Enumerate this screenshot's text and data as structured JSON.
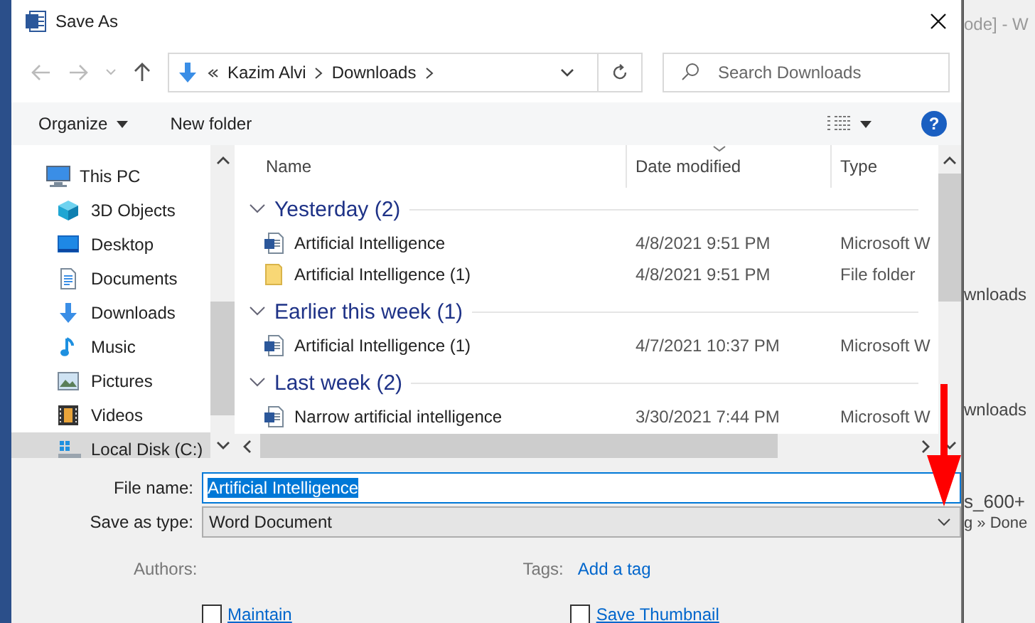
{
  "window": {
    "title": "Save As"
  },
  "address_bar": {
    "path": [
      "Kazim Alvi",
      "Downloads"
    ]
  },
  "search": {
    "placeholder": "Search Downloads"
  },
  "toolbar": {
    "organize": "Organize",
    "new_folder": "New folder",
    "help": "?"
  },
  "nav_items": [
    {
      "label": "This PC",
      "kind": "pc",
      "selected": false,
      "children": [
        {
          "label": "3D Objects",
          "kind": "cube",
          "selected": false
        },
        {
          "label": "Desktop",
          "kind": "desktop",
          "selected": false
        },
        {
          "label": "Documents",
          "kind": "documents",
          "selected": false
        },
        {
          "label": "Downloads",
          "kind": "downloads",
          "selected": false
        },
        {
          "label": "Music",
          "kind": "music",
          "selected": false
        },
        {
          "label": "Pictures",
          "kind": "pictures",
          "selected": false
        },
        {
          "label": "Videos",
          "kind": "videos",
          "selected": false
        },
        {
          "label": "Local Disk (C:)",
          "kind": "disk",
          "selected": true
        }
      ]
    }
  ],
  "columns": [
    {
      "label": "Name",
      "sorted": false
    },
    {
      "label": "Date modified",
      "sorted": true
    },
    {
      "label": "Type",
      "sorted": false
    }
  ],
  "groups": [
    {
      "label": "Yesterday (2)",
      "expanded": true,
      "files": [
        {
          "name": "Artificial Intelligence",
          "date": "4/8/2021 9:51 PM",
          "type": "Microsoft W",
          "kind": "word"
        },
        {
          "name": "Artificial Intelligence (1)",
          "date": "4/8/2021 9:51 PM",
          "type": "File folder",
          "kind": "folder"
        }
      ]
    },
    {
      "label": "Earlier this week (1)",
      "expanded": true,
      "files": [
        {
          "name": "Artificial Intelligence (1)",
          "date": "4/7/2021 10:37 PM",
          "type": "Microsoft W",
          "kind": "word"
        }
      ]
    },
    {
      "label": "Last week (2)",
      "expanded": true,
      "files": [
        {
          "name": "Narrow artificial intelligence",
          "date": "3/30/2021 7:44 PM",
          "type": "Microsoft W",
          "kind": "word"
        }
      ]
    }
  ],
  "form": {
    "file_name": {
      "label": "File name:",
      "value": "Artificial Intelligence"
    },
    "save_type": {
      "label": "Save as type:",
      "value": "Word Document"
    },
    "authors": {
      "label": "Authors:"
    },
    "tags": {
      "label": "Tags:",
      "link": "Add a tag"
    },
    "options": [
      {
        "label": "Maintain",
        "checked": false
      },
      {
        "label": "Save Thumbnail",
        "checked": false
      }
    ]
  },
  "background_window": {
    "texts": [
      "ode] - W",
      "wnloads",
      "wnloads",
      "s_600+",
      "g » Done"
    ]
  }
}
